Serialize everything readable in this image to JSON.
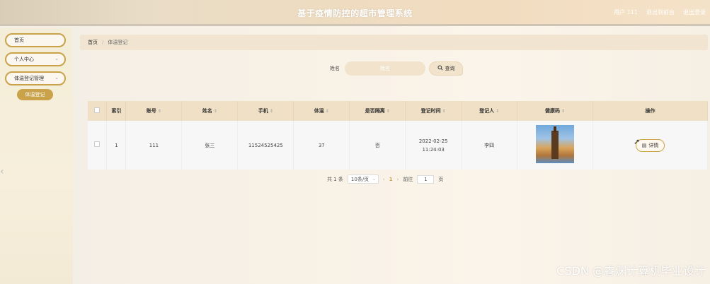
{
  "header": {
    "title": "基于疫情防控的超市管理系统",
    "links": [
      "用户 111",
      "退出到前台",
      "退出登录"
    ]
  },
  "sidebar": {
    "items": [
      {
        "label": "首页"
      },
      {
        "label": "个人中心"
      },
      {
        "label": "体温登记管理"
      }
    ],
    "submenu": {
      "label": "体温登记"
    }
  },
  "breadcrumb": {
    "home": "首页",
    "separator": "/",
    "current": "体温登记"
  },
  "search": {
    "label": "姓名",
    "placeholder": "姓名",
    "button": "查询"
  },
  "table": {
    "headers": [
      "索引",
      "账号",
      "姓名",
      "手机",
      "体温",
      "是否隔离",
      "登记时间",
      "登记人",
      "健康码",
      "操作"
    ],
    "rows": [
      {
        "index": "1",
        "account": "111",
        "name": "张三",
        "phone": "11524525425",
        "temperature": "37",
        "isolated": "否",
        "time": "2022-02-25 11:24:03",
        "registrar": "李四",
        "action": "详情"
      }
    ]
  },
  "pagination": {
    "total": "共 1 条",
    "page_size": "10条/页",
    "current_page": "1",
    "goto_label": "前往",
    "goto_value": "1",
    "page_unit": "页"
  },
  "watermark": "CSDN @睿渊计算机毕业设计",
  "colors": {
    "accent": "#c9a24a",
    "header_bg": "#f0e0c5"
  }
}
